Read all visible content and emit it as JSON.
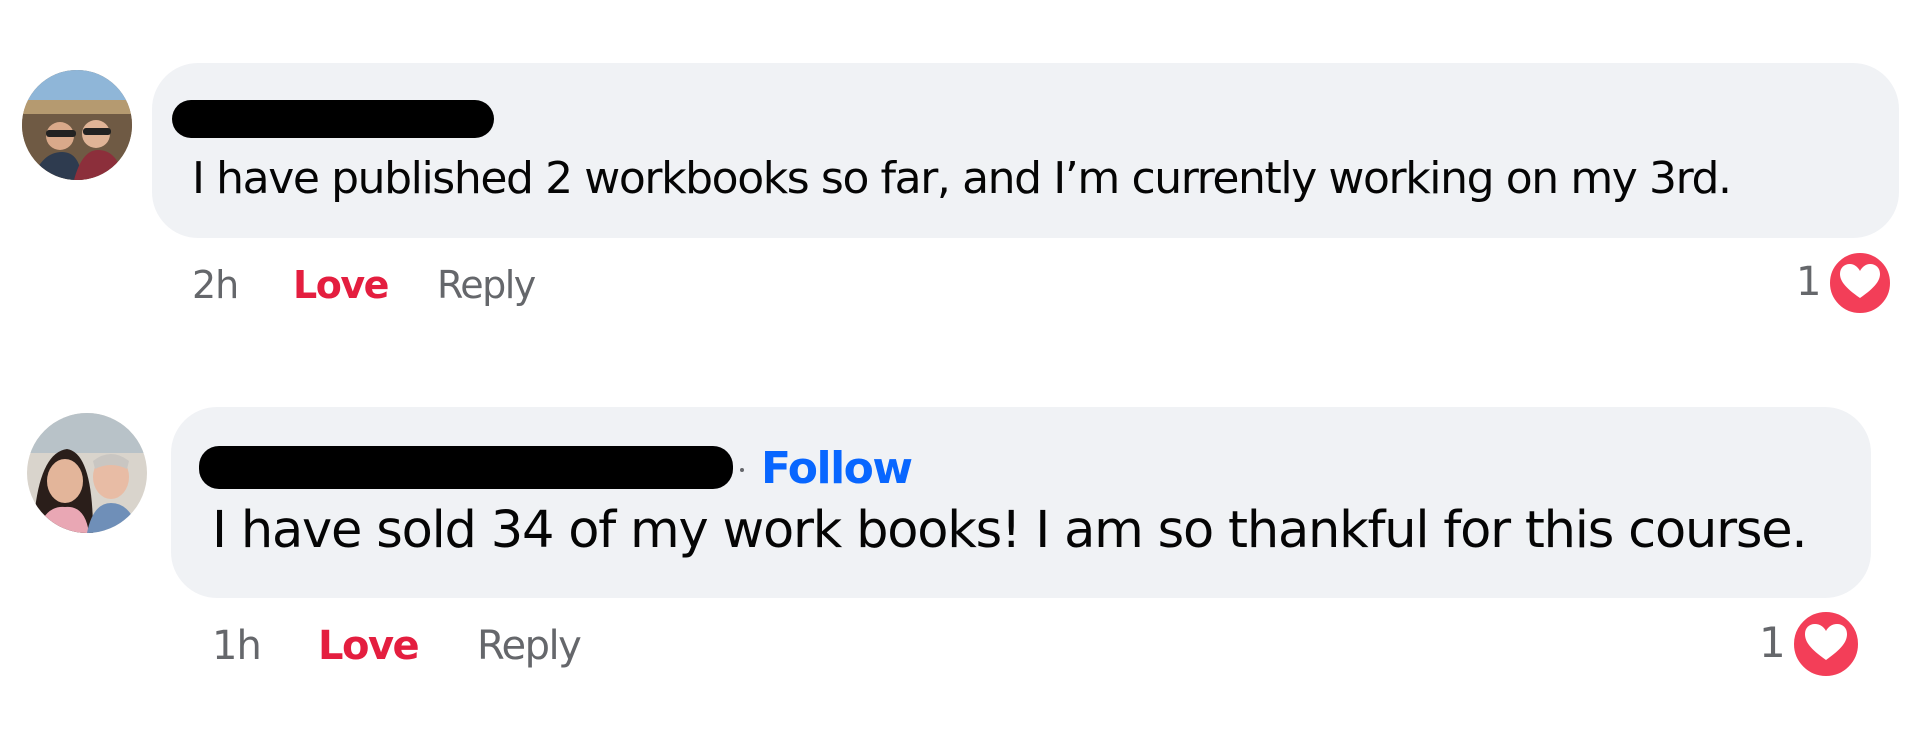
{
  "colors": {
    "bubble": "#f0f2f5",
    "love": "#e41e3f",
    "follow": "#0866ff",
    "meta": "#65676b",
    "love_reaction": "#f33e58"
  },
  "comments": [
    {
      "text": "I have published 2 workbooks so far, and I’m currently working on my 3rd.",
      "time": "2h",
      "love_label": "Love",
      "reply_label": "Reply",
      "reaction_count": "1",
      "reaction_icon": "heart-icon"
    },
    {
      "follow_label": "Follow",
      "text": "I have sold 34 of my work books! I am so thankful for this course.",
      "time": "1h",
      "love_label": "Love",
      "reply_label": "Reply",
      "reaction_count": "1",
      "reaction_icon": "heart-icon"
    }
  ]
}
